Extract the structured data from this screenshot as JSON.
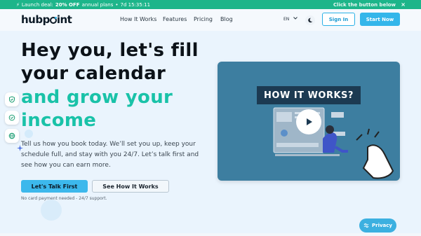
{
  "promo": {
    "icon": "bolt-icon",
    "text_prefix": "Launch deal:",
    "text_bold": "20% OFF",
    "text_suffix": "annual plans",
    "separator": "•",
    "countdown": "7d 15:35:11",
    "right_text": "Click the button below",
    "close": "×"
  },
  "header": {
    "logo_pre": "hubp",
    "logo_post": "int",
    "nav": [
      "How It Works",
      "Features",
      "Pricing",
      "Blog"
    ],
    "lang": "EN",
    "signin": "Sign In",
    "start": "Start Now"
  },
  "hero": {
    "line1": "Hey you, let's fill",
    "line2": "your calendar",
    "line3": "and grow your",
    "line4": "income",
    "subtitle": "Tell us how you book today. We’ll set you up, keep your schedule full, and stay with you 24/7. Let’s talk first and see how you can earn more.",
    "cta_primary": "Let's Talk First",
    "cta_secondary": "See How It Works",
    "note": "No card payment needed - 24/7 support."
  },
  "video": {
    "title": "HOW IT WORKS?"
  },
  "privacy": {
    "label": "Privacy"
  },
  "colors": {
    "promo": "#1db58a",
    "accent": "#34b6ea",
    "teal_heading": "#19c2a8",
    "video_bg": "#3d7ea0"
  }
}
